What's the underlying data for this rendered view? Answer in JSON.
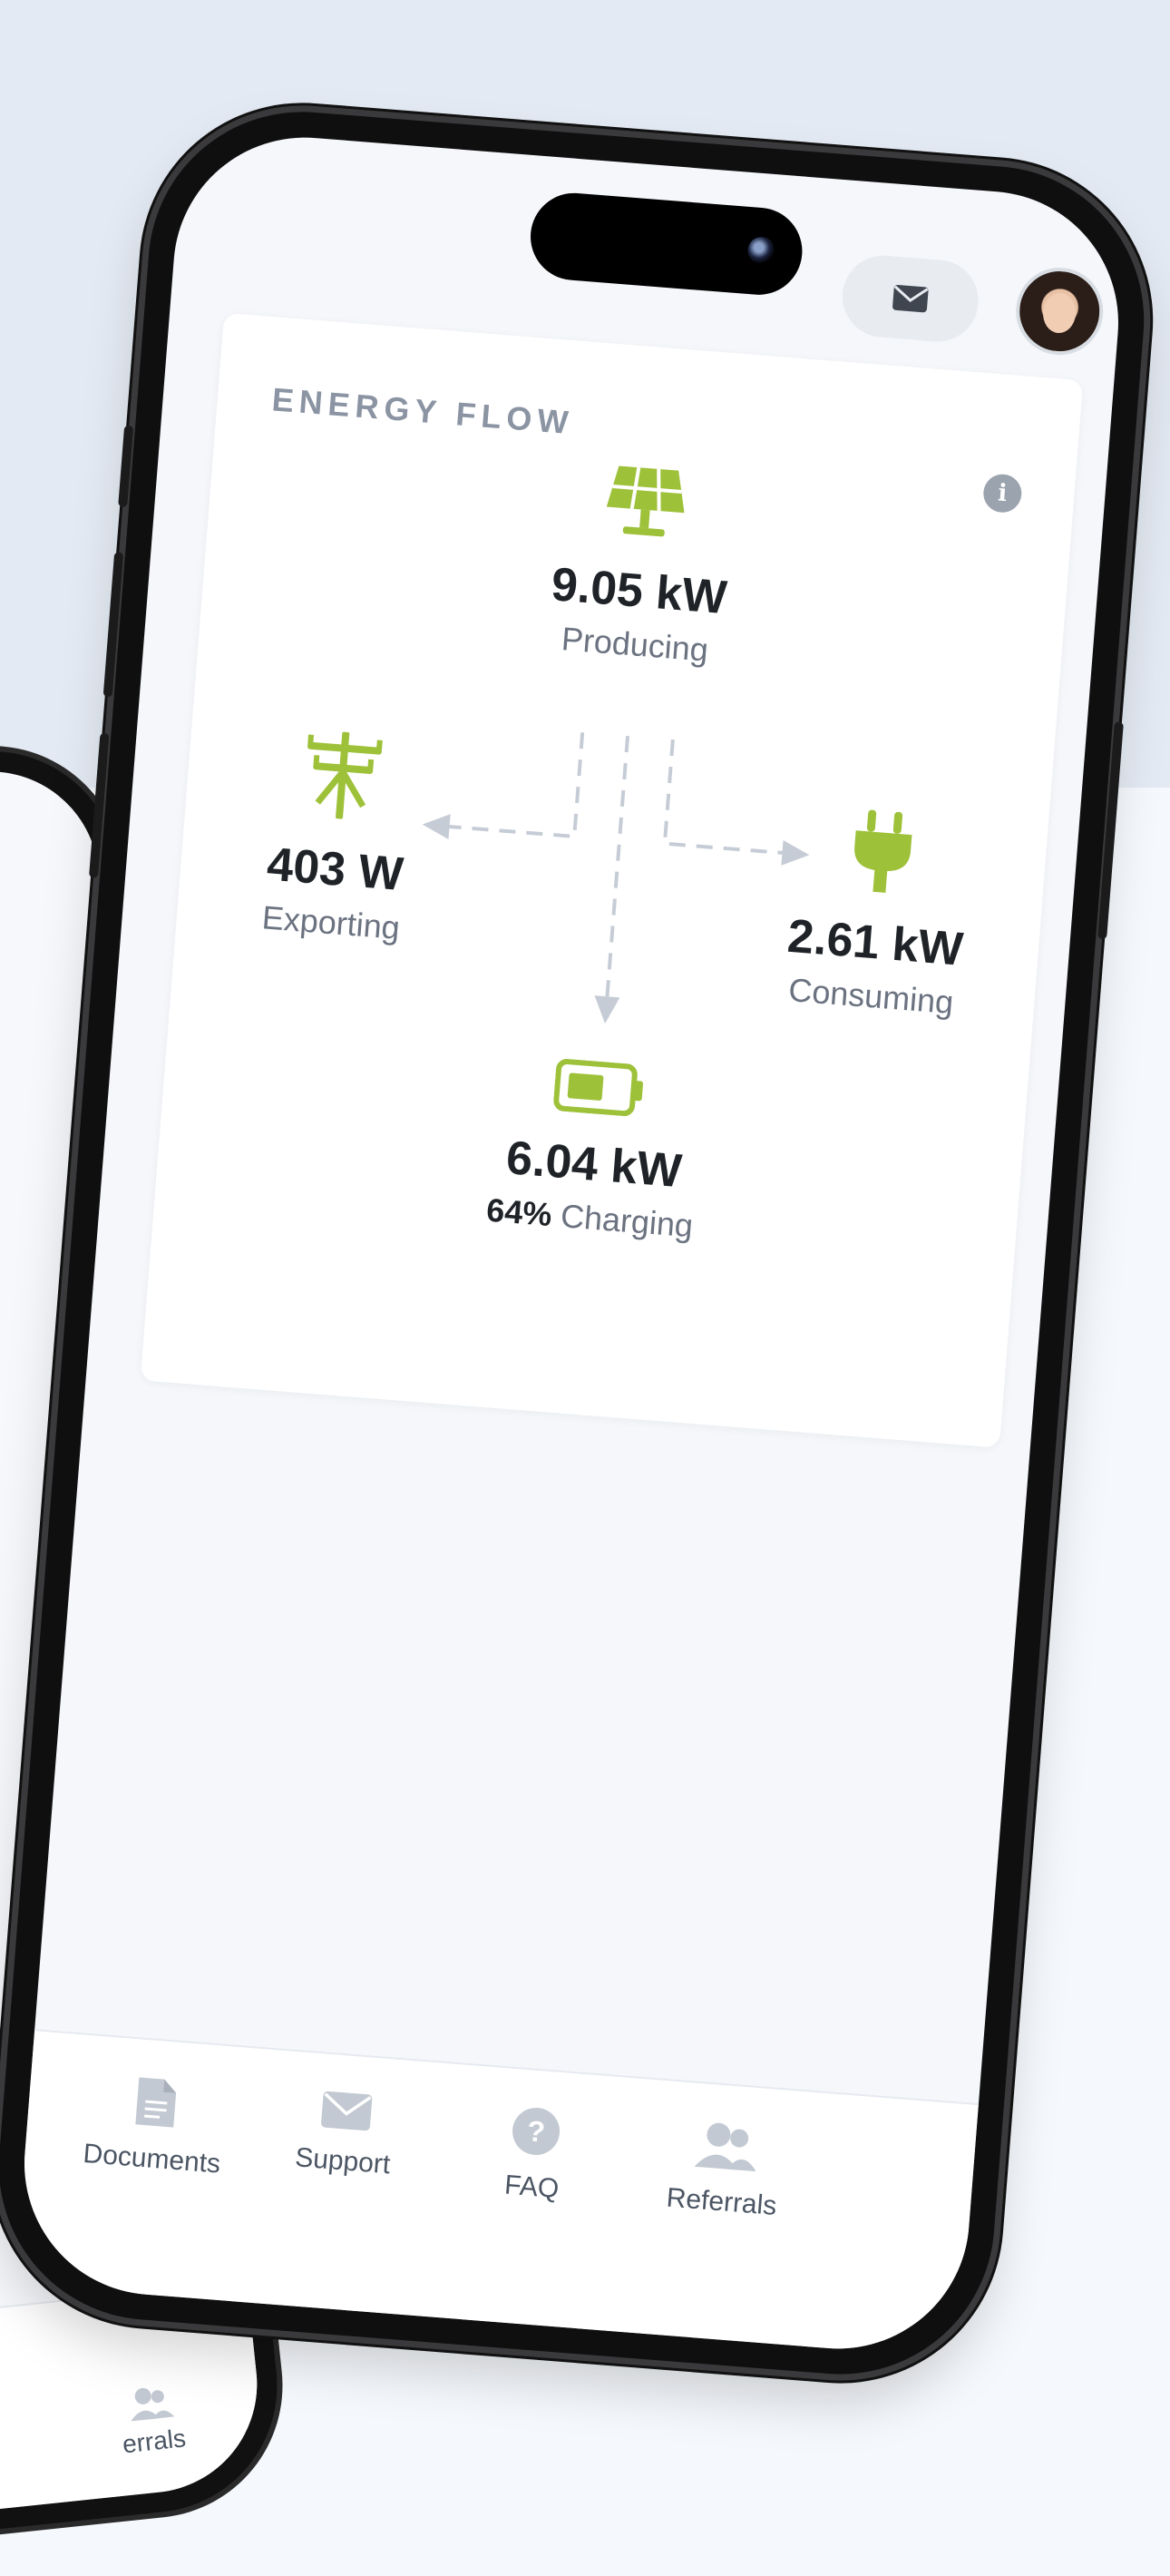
{
  "card": {
    "title": "ENERGY FLOW"
  },
  "flow": {
    "producing": {
      "value": "9.05 kW",
      "label": "Producing",
      "icon": "solar-panel-icon"
    },
    "exporting": {
      "value": "403 W",
      "label": "Exporting",
      "icon": "power-line-icon"
    },
    "consuming": {
      "value": "2.61 kW",
      "label": "Consuming",
      "icon": "plug-icon"
    },
    "charging": {
      "value": "6.04 kW",
      "percent": "64%",
      "label": "Charging",
      "icon": "battery-icon"
    }
  },
  "nav": {
    "items": [
      {
        "label": "Documents",
        "icon": "document-icon"
      },
      {
        "label": "Support",
        "icon": "mail-icon"
      },
      {
        "label": "FAQ",
        "icon": "question-icon"
      },
      {
        "label": "Referrals",
        "icon": "people-icon"
      }
    ]
  },
  "back_phone": {
    "nav_label": "errals"
  },
  "colors": {
    "accent": "#9ec13a",
    "flow_line": "#c6ccd6",
    "text": "#1f2328",
    "muted": "#6b7280"
  }
}
